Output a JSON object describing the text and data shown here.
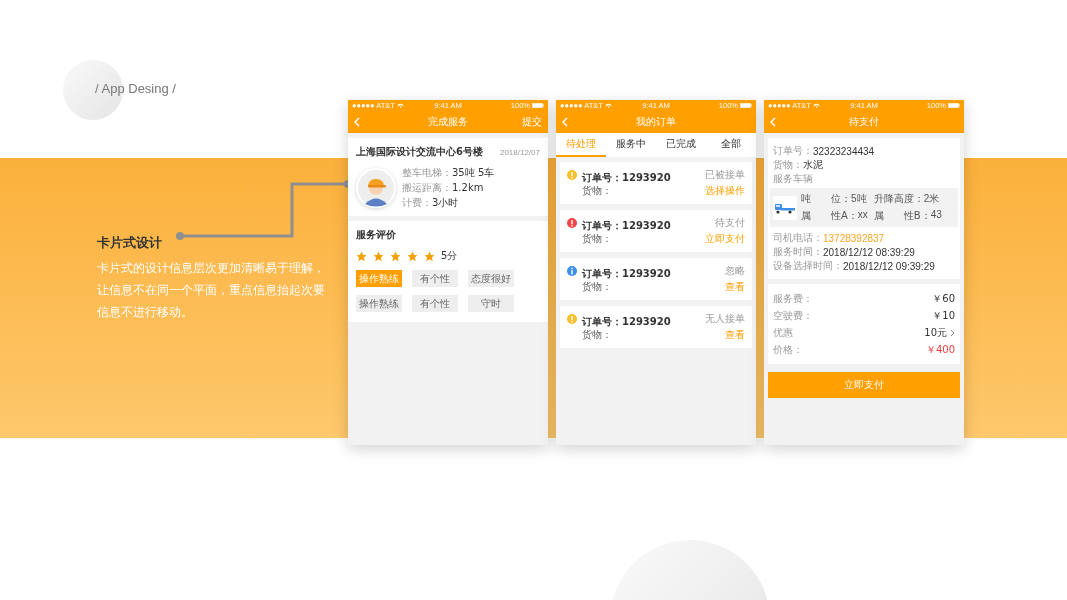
{
  "header": {
    "label": "/ App Desing /"
  },
  "feature": {
    "title": "卡片式设计",
    "description": "卡片式的设计信息层次更加清晰易于理解，让信息不在同一个平面，重点信息抬起次要信息不进行移动。"
  },
  "screens": [
    {
      "kind": "service",
      "status_bar": {
        "carrier": "●●●●● AT&T",
        "time": "9:41 AM",
        "battery": "100%"
      },
      "title": "完成服务",
      "action": "提交",
      "address": "上海国际设计交流中心6号楼",
      "date": "2018/12/07",
      "details": [
        {
          "label": "整车电梯：",
          "value": "35吨  5车"
        },
        {
          "label": "搬运距离：",
          "value": "1.2km"
        },
        {
          "label": "计费：",
          "value": "3小时"
        }
      ],
      "rating": {
        "title": "服务评价",
        "stars": 5,
        "score": "5分"
      },
      "tags": [
        {
          "label": "操作熟练",
          "selected": true
        },
        {
          "label": "有个性",
          "selected": false
        },
        {
          "label": "态度很好",
          "selected": false
        },
        {
          "label": "操作熟练",
          "selected": false
        },
        {
          "label": "有个性",
          "selected": false
        },
        {
          "label": "守时",
          "selected": false
        }
      ]
    },
    {
      "kind": "orders",
      "status_bar": {
        "carrier": "●●●●● AT&T",
        "time": "9:41 AM",
        "battery": "100%"
      },
      "title": "我的订单",
      "tabs": [
        {
          "label": "待处理",
          "selected": true
        },
        {
          "label": "服务中",
          "selected": false
        },
        {
          "label": "已完成",
          "selected": false
        },
        {
          "label": "全部",
          "selected": false
        }
      ],
      "orders": [
        {
          "kind": "alert",
          "color": "#fbc02d",
          "number_label": "订单号：",
          "number": "1293920",
          "state": "已被接单",
          "goods_label": "货物：",
          "action": "选择操作"
        },
        {
          "kind": "alert",
          "color": "#f04848",
          "number_label": "订单号：",
          "number": "1293920",
          "state": "待支付",
          "goods_label": "货物：",
          "action": "立即支付"
        },
        {
          "kind": "info",
          "color": "#3d8fe8",
          "number_label": "订单号：",
          "number": "1293920",
          "state": "忽略",
          "goods_label": "货物：",
          "action": "查看"
        },
        {
          "kind": "alert",
          "color": "#fbc02d",
          "number_label": "订单号：",
          "number": "1293920",
          "state": "无人接单",
          "goods_label": "货物：",
          "action": "查看"
        }
      ]
    },
    {
      "kind": "payment",
      "status_bar": {
        "carrier": "●●●●● AT&T",
        "time": "9:41 AM",
        "battery": "100%"
      },
      "title": "待支付",
      "info": [
        {
          "label": "订单号：",
          "value": "32323234434"
        },
        {
          "label": "货物：",
          "value": "水泥"
        }
      ],
      "vehicle_heading": "服务车辆",
      "vehicle_specs": [
        {
          "label": "吨　　位：",
          "value": "5吨"
        },
        {
          "label": "升降高度：",
          "value": "2米"
        },
        {
          "label": "属　　性A：",
          "value": "xx"
        },
        {
          "label": "属　　性B：",
          "value": "43"
        }
      ],
      "contact": [
        {
          "label": "司机电话：",
          "value": "13728392837",
          "color": "#f5a623"
        },
        {
          "label": "服务时间：",
          "value": "2018/12/12  08:39:29"
        },
        {
          "label": "设备选择时间：",
          "value": "2018/12/12  09:39:29"
        }
      ],
      "fees": [
        {
          "kind": "plain",
          "label": "服务费：",
          "value": "￥60"
        },
        {
          "kind": "plain",
          "label": "空驶费：",
          "value": "￥10"
        },
        {
          "kind": "link",
          "label": "优惠",
          "value": "10元"
        },
        {
          "kind": "plain",
          "label": "价格：",
          "value": "￥400",
          "color": "#f03c3c"
        }
      ],
      "button": "立即支付"
    }
  ]
}
